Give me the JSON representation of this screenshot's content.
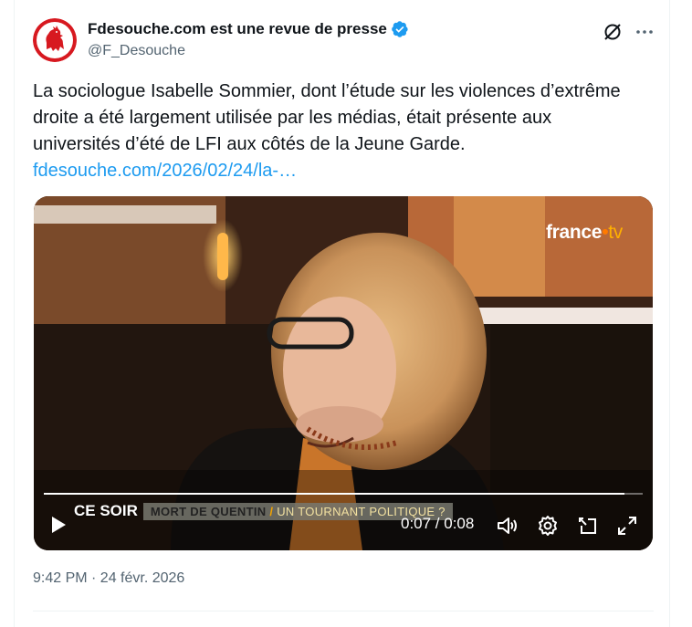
{
  "author": {
    "display_name": "Fdesouche.com est une revue de presse",
    "handle": "@F_Desouche",
    "avatar_icon": "rooster-logo-icon",
    "verified_icon": "verified-badge-icon"
  },
  "actions": {
    "grok_icon": "grok-icon",
    "more_icon": "more-options-icon"
  },
  "tweet": {
    "lines": [
      "La sociologue Isabelle Sommier, dont l’étude sur les violences d’extrême",
      "droite a été largement utilisée par les médias, était présente aux",
      "universités d’été de LFI aux côtés de la Jeune Garde."
    ],
    "link_text": "fdesouche.com/2026/02/24/la-…"
  },
  "video": {
    "brand": {
      "main": "france",
      "dot": "•",
      "tv": "tv"
    },
    "show_name": "CE SOIR",
    "ticker_main": "MORT DE QUENTIN",
    "ticker_sep": "/",
    "ticker_rest": "UN TOURNANT POLITIQUE ?",
    "progress": 0.97,
    "time_label": "0:07 / 0:08",
    "controls": [
      "play-icon",
      "volume-icon",
      "settings-icon",
      "pip-icon",
      "fullscreen-icon"
    ]
  },
  "footer": {
    "timestamp": "9:42 PM · 24 févr. 2026"
  },
  "colors": {
    "accent": "#1d9bf0",
    "text": "#0f1419",
    "muted": "#536471"
  }
}
